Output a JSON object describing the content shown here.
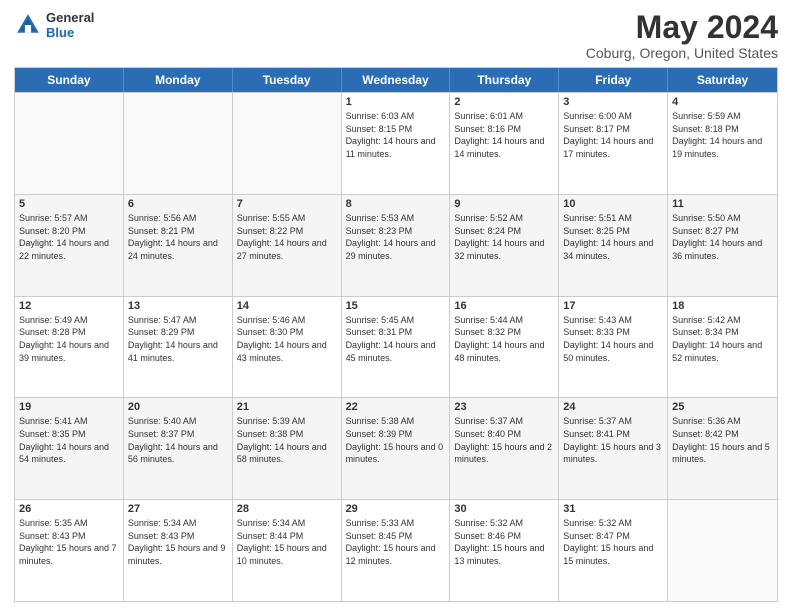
{
  "logo": {
    "general": "General",
    "blue": "Blue"
  },
  "title": "May 2024",
  "subtitle": "Coburg, Oregon, United States",
  "weekdays": [
    "Sunday",
    "Monday",
    "Tuesday",
    "Wednesday",
    "Thursday",
    "Friday",
    "Saturday"
  ],
  "weeks": [
    [
      {
        "day": "",
        "sunrise": "",
        "sunset": "",
        "daylight": ""
      },
      {
        "day": "",
        "sunrise": "",
        "sunset": "",
        "daylight": ""
      },
      {
        "day": "",
        "sunrise": "",
        "sunset": "",
        "daylight": ""
      },
      {
        "day": "1",
        "sunrise": "Sunrise: 6:03 AM",
        "sunset": "Sunset: 8:15 PM",
        "daylight": "Daylight: 14 hours and 11 minutes."
      },
      {
        "day": "2",
        "sunrise": "Sunrise: 6:01 AM",
        "sunset": "Sunset: 8:16 PM",
        "daylight": "Daylight: 14 hours and 14 minutes."
      },
      {
        "day": "3",
        "sunrise": "Sunrise: 6:00 AM",
        "sunset": "Sunset: 8:17 PM",
        "daylight": "Daylight: 14 hours and 17 minutes."
      },
      {
        "day": "4",
        "sunrise": "Sunrise: 5:59 AM",
        "sunset": "Sunset: 8:18 PM",
        "daylight": "Daylight: 14 hours and 19 minutes."
      }
    ],
    [
      {
        "day": "5",
        "sunrise": "Sunrise: 5:57 AM",
        "sunset": "Sunset: 8:20 PM",
        "daylight": "Daylight: 14 hours and 22 minutes."
      },
      {
        "day": "6",
        "sunrise": "Sunrise: 5:56 AM",
        "sunset": "Sunset: 8:21 PM",
        "daylight": "Daylight: 14 hours and 24 minutes."
      },
      {
        "day": "7",
        "sunrise": "Sunrise: 5:55 AM",
        "sunset": "Sunset: 8:22 PM",
        "daylight": "Daylight: 14 hours and 27 minutes."
      },
      {
        "day": "8",
        "sunrise": "Sunrise: 5:53 AM",
        "sunset": "Sunset: 8:23 PM",
        "daylight": "Daylight: 14 hours and 29 minutes."
      },
      {
        "day": "9",
        "sunrise": "Sunrise: 5:52 AM",
        "sunset": "Sunset: 8:24 PM",
        "daylight": "Daylight: 14 hours and 32 minutes."
      },
      {
        "day": "10",
        "sunrise": "Sunrise: 5:51 AM",
        "sunset": "Sunset: 8:25 PM",
        "daylight": "Daylight: 14 hours and 34 minutes."
      },
      {
        "day": "11",
        "sunrise": "Sunrise: 5:50 AM",
        "sunset": "Sunset: 8:27 PM",
        "daylight": "Daylight: 14 hours and 36 minutes."
      }
    ],
    [
      {
        "day": "12",
        "sunrise": "Sunrise: 5:49 AM",
        "sunset": "Sunset: 8:28 PM",
        "daylight": "Daylight: 14 hours and 39 minutes."
      },
      {
        "day": "13",
        "sunrise": "Sunrise: 5:47 AM",
        "sunset": "Sunset: 8:29 PM",
        "daylight": "Daylight: 14 hours and 41 minutes."
      },
      {
        "day": "14",
        "sunrise": "Sunrise: 5:46 AM",
        "sunset": "Sunset: 8:30 PM",
        "daylight": "Daylight: 14 hours and 43 minutes."
      },
      {
        "day": "15",
        "sunrise": "Sunrise: 5:45 AM",
        "sunset": "Sunset: 8:31 PM",
        "daylight": "Daylight: 14 hours and 45 minutes."
      },
      {
        "day": "16",
        "sunrise": "Sunrise: 5:44 AM",
        "sunset": "Sunset: 8:32 PM",
        "daylight": "Daylight: 14 hours and 48 minutes."
      },
      {
        "day": "17",
        "sunrise": "Sunrise: 5:43 AM",
        "sunset": "Sunset: 8:33 PM",
        "daylight": "Daylight: 14 hours and 50 minutes."
      },
      {
        "day": "18",
        "sunrise": "Sunrise: 5:42 AM",
        "sunset": "Sunset: 8:34 PM",
        "daylight": "Daylight: 14 hours and 52 minutes."
      }
    ],
    [
      {
        "day": "19",
        "sunrise": "Sunrise: 5:41 AM",
        "sunset": "Sunset: 8:35 PM",
        "daylight": "Daylight: 14 hours and 54 minutes."
      },
      {
        "day": "20",
        "sunrise": "Sunrise: 5:40 AM",
        "sunset": "Sunset: 8:37 PM",
        "daylight": "Daylight: 14 hours and 56 minutes."
      },
      {
        "day": "21",
        "sunrise": "Sunrise: 5:39 AM",
        "sunset": "Sunset: 8:38 PM",
        "daylight": "Daylight: 14 hours and 58 minutes."
      },
      {
        "day": "22",
        "sunrise": "Sunrise: 5:38 AM",
        "sunset": "Sunset: 8:39 PM",
        "daylight": "Daylight: 15 hours and 0 minutes."
      },
      {
        "day": "23",
        "sunrise": "Sunrise: 5:37 AM",
        "sunset": "Sunset: 8:40 PM",
        "daylight": "Daylight: 15 hours and 2 minutes."
      },
      {
        "day": "24",
        "sunrise": "Sunrise: 5:37 AM",
        "sunset": "Sunset: 8:41 PM",
        "daylight": "Daylight: 15 hours and 3 minutes."
      },
      {
        "day": "25",
        "sunrise": "Sunrise: 5:36 AM",
        "sunset": "Sunset: 8:42 PM",
        "daylight": "Daylight: 15 hours and 5 minutes."
      }
    ],
    [
      {
        "day": "26",
        "sunrise": "Sunrise: 5:35 AM",
        "sunset": "Sunset: 8:43 PM",
        "daylight": "Daylight: 15 hours and 7 minutes."
      },
      {
        "day": "27",
        "sunrise": "Sunrise: 5:34 AM",
        "sunset": "Sunset: 8:43 PM",
        "daylight": "Daylight: 15 hours and 9 minutes."
      },
      {
        "day": "28",
        "sunrise": "Sunrise: 5:34 AM",
        "sunset": "Sunset: 8:44 PM",
        "daylight": "Daylight: 15 hours and 10 minutes."
      },
      {
        "day": "29",
        "sunrise": "Sunrise: 5:33 AM",
        "sunset": "Sunset: 8:45 PM",
        "daylight": "Daylight: 15 hours and 12 minutes."
      },
      {
        "day": "30",
        "sunrise": "Sunrise: 5:32 AM",
        "sunset": "Sunset: 8:46 PM",
        "daylight": "Daylight: 15 hours and 13 minutes."
      },
      {
        "day": "31",
        "sunrise": "Sunrise: 5:32 AM",
        "sunset": "Sunset: 8:47 PM",
        "daylight": "Daylight: 15 hours and 15 minutes."
      },
      {
        "day": "",
        "sunrise": "",
        "sunset": "",
        "daylight": ""
      }
    ]
  ]
}
